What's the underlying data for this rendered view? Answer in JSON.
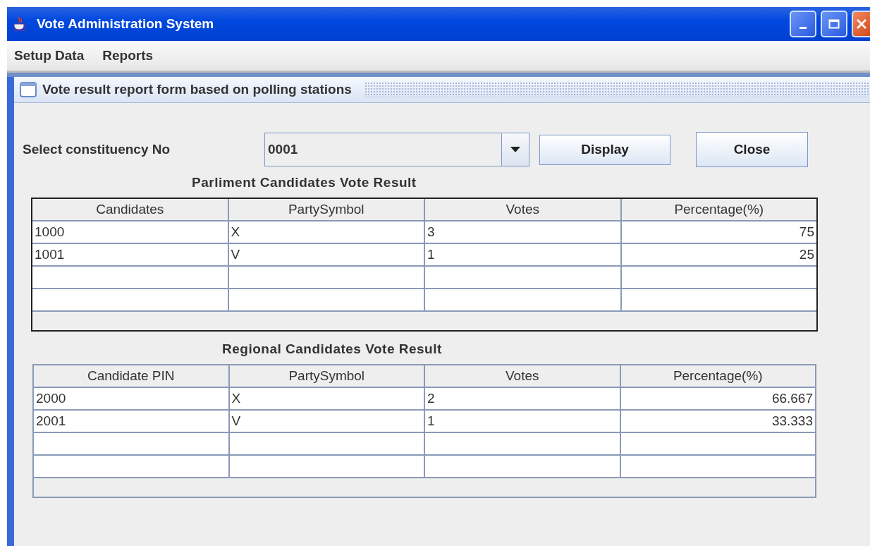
{
  "window": {
    "title": "Vote Administration System"
  },
  "menu": [
    "Setup Data",
    "Reports"
  ],
  "form": {
    "title": "Vote result report form based on polling stations",
    "constituency": {
      "label": "Select constituency No",
      "value": "0001"
    },
    "buttons": [
      "Display",
      "Close"
    ],
    "tables": [
      {
        "title": "Parliment Candidates Vote Result",
        "columns": [
          "Candidates",
          "PartySymbol",
          "Votes",
          "Percentage(%)"
        ],
        "rows": [
          [
            "1000",
            "X",
            "3",
            "75"
          ],
          [
            "1001",
            "V",
            "1",
            "25"
          ]
        ]
      },
      {
        "title": "Regional Candidates Vote Result",
        "columns": [
          "Candidate PIN",
          "PartySymbol",
          "Votes",
          "Percentage(%)"
        ],
        "rows": [
          [
            "2000",
            "X",
            "2",
            "66.667"
          ],
          [
            "2001",
            "V",
            "1",
            "33.333"
          ]
        ]
      }
    ]
  }
}
